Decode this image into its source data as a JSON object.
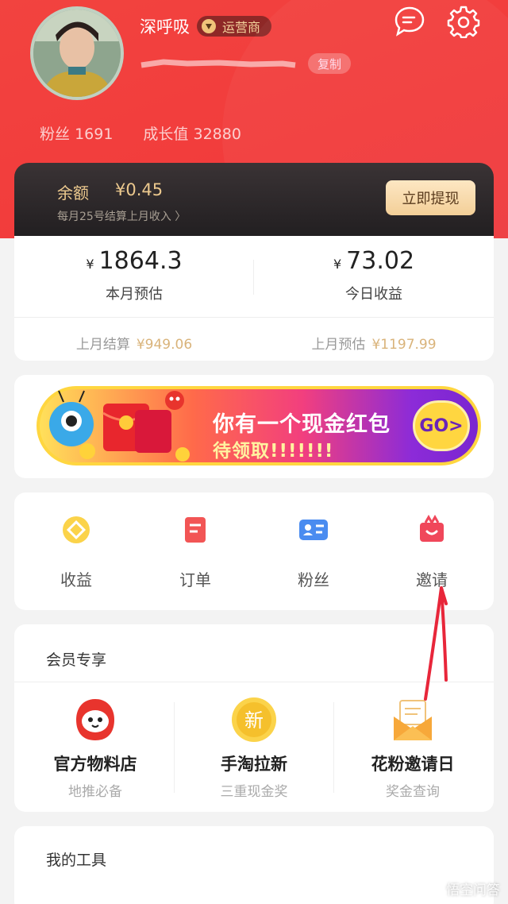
{
  "profile": {
    "username": "深呼吸",
    "role_badge": "运营商",
    "copy_label": "复制",
    "fans_label": "粉丝",
    "fans_value": "1691",
    "growth_label": "成长值",
    "growth_value": "32880"
  },
  "balance": {
    "label": "余额",
    "amount": "¥0.45",
    "note": "每月25号结算上月收入",
    "withdraw_label": "立即提现"
  },
  "earnings": {
    "currency": "¥",
    "month_value": "1864.3",
    "month_label": "本月预估",
    "today_value": "73.02",
    "today_label": "今日收益",
    "last_settle_label": "上月结算",
    "last_settle_value": "¥949.06",
    "last_estimate_label": "上月预估",
    "last_estimate_value": "¥1197.99"
  },
  "banner": {
    "line1": "你有一个现金红包",
    "line2": "待领取!!!!!!!",
    "go_label": "GO>"
  },
  "quick_actions": [
    {
      "label": "收益",
      "icon": "diamond-icon"
    },
    {
      "label": "订单",
      "icon": "order-icon"
    },
    {
      "label": "粉丝",
      "icon": "id-card-icon"
    },
    {
      "label": "邀请",
      "icon": "gift-icon"
    }
  ],
  "member": {
    "title": "会员专享",
    "items": [
      {
        "title": "官方物料店",
        "subtitle": "地推必备",
        "icon": "mascot-icon"
      },
      {
        "title": "手淘拉新",
        "subtitle": "三重现金奖",
        "icon": "new-coin-icon",
        "icon_text": "新"
      },
      {
        "title": "花粉邀请日",
        "subtitle": "奖金查询",
        "icon": "envelope-icon"
      }
    ]
  },
  "tools": {
    "title": "我的工具"
  },
  "watermark": "悟空问答",
  "colors": {
    "header_red": "#f2433f",
    "gold": "#ecc98e",
    "dark_card": "#2a2527"
  }
}
